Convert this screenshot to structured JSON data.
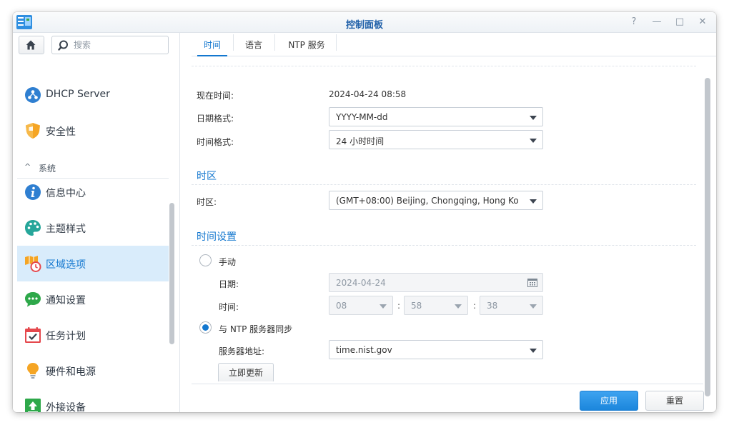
{
  "window": {
    "title": "控制面板",
    "controls": [
      "?",
      "—",
      "□",
      "✕"
    ]
  },
  "sidebar": {
    "search_placeholder": "搜索",
    "items_top": [
      {
        "label": "DHCP Server",
        "icon": "dhcp-icon"
      },
      {
        "label": "安全性",
        "icon": "shield-icon"
      }
    ],
    "section": {
      "label": "系统",
      "chevron": "^"
    },
    "items": [
      {
        "label": "信息中心",
        "icon": "info-icon"
      },
      {
        "label": "主题样式",
        "icon": "palette-icon"
      },
      {
        "label": "区域选项",
        "icon": "regional-options-icon",
        "active": true
      },
      {
        "label": "通知设置",
        "icon": "notification-icon"
      },
      {
        "label": "任务计划",
        "icon": "calendar-task-icon"
      },
      {
        "label": "硬件和电源",
        "icon": "bulb-icon"
      },
      {
        "label": "外接设备",
        "icon": "external-device-icon"
      }
    ]
  },
  "tabs": [
    {
      "label": "时间",
      "active": true
    },
    {
      "label": "语言"
    },
    {
      "label": "NTP 服务"
    }
  ],
  "time": {
    "current_time_label": "现在时间:",
    "current_time_value": "2024-04-24 08:58",
    "date_format_label": "日期格式:",
    "date_format_value": "YYYY-MM-dd",
    "time_format_label": "时间格式:",
    "time_format_value": "24 小时时间"
  },
  "timezone": {
    "section_title": "时区",
    "label": "时区:",
    "value": "(GMT+08:00) Beijing, Chongqing, Hong Ko"
  },
  "time_settings": {
    "section_title": "时间设置",
    "manual_label": "手动",
    "manual_selected": false,
    "date_label": "日期:",
    "date_value": "2024-04-24",
    "time_label": "时间:",
    "hour": "08",
    "minute": "58",
    "second": "38",
    "colon": ":",
    "ntp_label": "与 NTP 服务器同步",
    "ntp_selected": true,
    "server_label": "服务器地址:",
    "server_value": "time.nist.gov",
    "update_now_button": "立即更新"
  },
  "footer": {
    "apply_button": "应用",
    "reset_button": "重置"
  },
  "colors": {
    "accent": "#1377cf",
    "active_bg": "#d9ecfb",
    "primary_button": "#2a93e6"
  }
}
